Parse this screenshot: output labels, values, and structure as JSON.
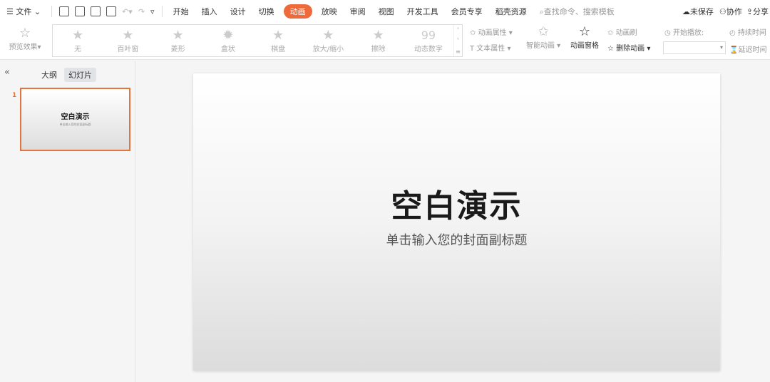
{
  "menubar": {
    "file": "文件",
    "tabs": [
      "开始",
      "插入",
      "设计",
      "切换",
      "动画",
      "放映",
      "审阅",
      "视图",
      "开发工具",
      "会员专享",
      "稻壳资源"
    ],
    "active_tab": "动画",
    "search_placeholder": "查找命令、搜索模板",
    "unsaved": "未保存",
    "collab": "协作",
    "share": "分享"
  },
  "ribbon": {
    "preview": "预览效果",
    "effects": [
      "无",
      "百叶窗",
      "菱形",
      "盒状",
      "棋盘",
      "放大/缩小",
      "擦除",
      "动态数字"
    ],
    "anim_props": "动画属性",
    "text_props": "文本属性",
    "smart_anim": "智能动画",
    "anim_pane": "动画窗格",
    "anim_brush": "动画刷",
    "delete_anim": "删除动画",
    "start_play": "开始播放:",
    "duration": "持续时间",
    "delay": "延迟时间"
  },
  "panel": {
    "outline_tab": "大纲",
    "slides_tab": "幻灯片",
    "slide_number": "1",
    "thumb_title": "空白演示",
    "thumb_subtitle": "单击输入您的封面副标题"
  },
  "slide": {
    "title": "空白演示",
    "subtitle": "单击输入您的封面副标题"
  },
  "colors": {
    "accent": "#ee6a3a"
  }
}
